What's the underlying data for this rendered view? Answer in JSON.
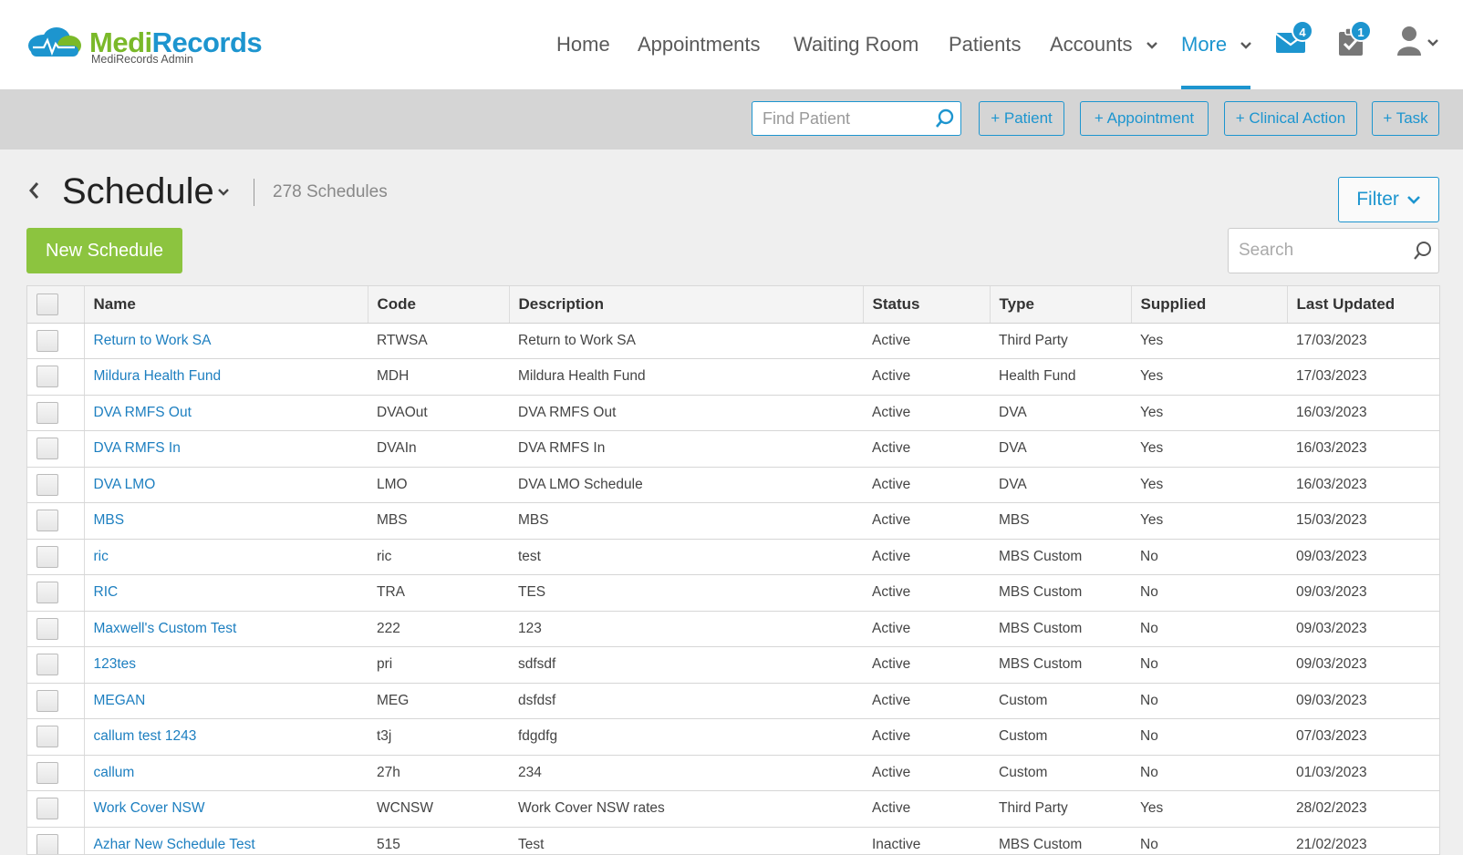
{
  "app": {
    "logo_part1": "Medi",
    "logo_part2": "Records",
    "logo_sub": "MediRecords Admin"
  },
  "nav": {
    "items": [
      "Home",
      "Appointments",
      "Waiting Room",
      "Patients",
      "Accounts",
      "More"
    ],
    "active": "More",
    "mail_badge": "4",
    "tasks_badge": "1"
  },
  "actionbar": {
    "find_placeholder": "Find Patient",
    "buttons": [
      "+ Patient",
      "+ Appointment",
      "+ Clinical Action",
      "+ Task"
    ]
  },
  "page": {
    "title": "Schedule",
    "count": "278 Schedules",
    "filter_label": "Filter",
    "new_label": "New Schedule",
    "search_placeholder": "Search"
  },
  "table": {
    "columns": [
      "Name",
      "Code",
      "Description",
      "Status",
      "Type",
      "Supplied",
      "Last Updated"
    ],
    "rows": [
      [
        "Return to Work SA",
        "RTWSA",
        "Return to Work SA",
        "Active",
        "Third Party",
        "Yes",
        "17/03/2023"
      ],
      [
        "Mildura Health Fund",
        "MDH",
        "Mildura Health Fund",
        "Active",
        "Health Fund",
        "Yes",
        "17/03/2023"
      ],
      [
        "DVA RMFS Out",
        "DVAOut",
        "DVA RMFS Out",
        "Active",
        "DVA",
        "Yes",
        "16/03/2023"
      ],
      [
        "DVA RMFS In",
        "DVAIn",
        "DVA RMFS In",
        "Active",
        "DVA",
        "Yes",
        "16/03/2023"
      ],
      [
        "DVA LMO",
        "LMO",
        "DVA LMO Schedule",
        "Active",
        "DVA",
        "Yes",
        "16/03/2023"
      ],
      [
        "MBS",
        "MBS",
        "MBS",
        "Active",
        "MBS",
        "Yes",
        "15/03/2023"
      ],
      [
        "ric",
        "ric",
        "test",
        "Active",
        "MBS Custom",
        "No",
        "09/03/2023"
      ],
      [
        "RIC",
        "TRA",
        "TES",
        "Active",
        "MBS Custom",
        "No",
        "09/03/2023"
      ],
      [
        "Maxwell's Custom Test",
        "222",
        "123",
        "Active",
        "MBS Custom",
        "No",
        "09/03/2023"
      ],
      [
        "123tes",
        "pri",
        "sdfsdf",
        "Active",
        "MBS Custom",
        "No",
        "09/03/2023"
      ],
      [
        "MEGAN",
        "MEG",
        "dsfdsf",
        "Active",
        "Custom",
        "No",
        "09/03/2023"
      ],
      [
        "callum test 1243",
        "t3j",
        "fdgdfg",
        "Active",
        "Custom",
        "No",
        "07/03/2023"
      ],
      [
        "callum",
        "27h",
        "234",
        "Active",
        "Custom",
        "No",
        "01/03/2023"
      ],
      [
        "Work Cover NSW",
        "WCNSW",
        "Work Cover NSW rates",
        "Active",
        "Third Party",
        "Yes",
        "28/02/2023"
      ],
      [
        "Azhar New Schedule Test",
        "515",
        "Test",
        "Inactive",
        "MBS Custom",
        "No",
        "21/02/2023"
      ]
    ]
  },
  "colors": {
    "accent_blue": "#1d95cf",
    "brand_green": "#7ab929",
    "new_button_green": "#8cc43f"
  }
}
